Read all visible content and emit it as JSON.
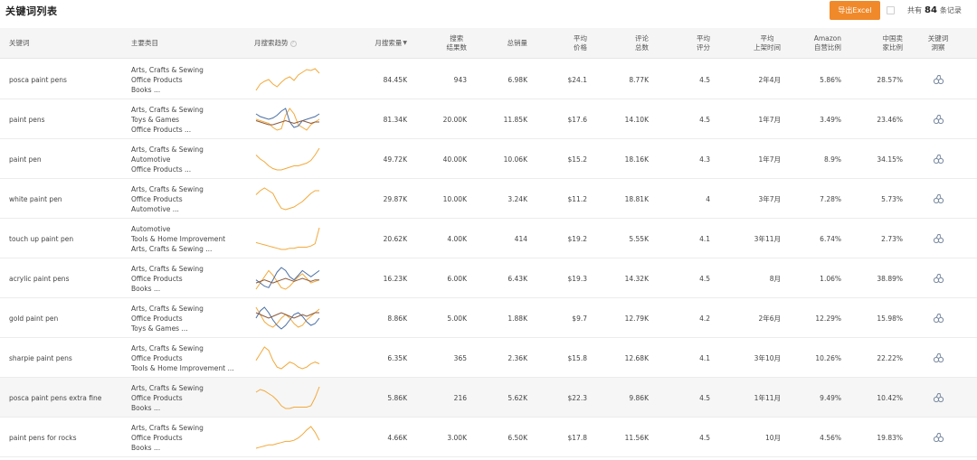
{
  "header": {
    "title": "关键词列表",
    "export_label": "导出Excel",
    "total_prefix": "共有",
    "total_count": "84",
    "total_suffix": "条记录"
  },
  "columns": {
    "keyword": "关键词",
    "category": "主要类目",
    "trend": "月搜索趋势",
    "volume": "月搜索量",
    "results_l1": "搜索",
    "results_l2": "结果数",
    "sales": "总销量",
    "price_l1": "平均",
    "price_l2": "价格",
    "reviews_l1": "评论",
    "reviews_l2": "总数",
    "rating_l1": "平均",
    "rating_l2": "评分",
    "time_l1": "平均",
    "time_l2": "上架时间",
    "amz_l1": "Amazon",
    "amz_l2": "自营比例",
    "cn_l1": "中国卖",
    "cn_l2": "家比例",
    "analysis_l1": "关键词",
    "analysis_l2": "洞察"
  },
  "colors": {
    "accent": "#f0892a",
    "trend_primary": "#f2a93b",
    "trend_secondary": "#4a6fa5",
    "trend_tertiary": "#8b5a3c",
    "analysis_icon": "#7a8aa0"
  },
  "icons": {
    "help": "question-circle-icon",
    "sort": "sort-desc-icon",
    "analysis": "keyword-insight-icon"
  },
  "rows": [
    {
      "keyword": "posca paint pens",
      "cat1": "Arts, Crafts & Sewing",
      "cat2": "Office Products",
      "cat3": "Books ...",
      "volume": "84.45K",
      "results": "943",
      "sales": "6.98K",
      "price": "$24.1",
      "reviews": "8.77K",
      "rating": "4.5",
      "time": "2年4月",
      "amz": "5.86%",
      "cn": "28.57%",
      "trend": [
        [
          5,
          12,
          15,
          17,
          12,
          9,
          14,
          18,
          20,
          16,
          22,
          25,
          28,
          27,
          29,
          24
        ]
      ]
    },
    {
      "keyword": "paint pens",
      "cat1": "Arts, Crafts & Sewing",
      "cat2": "Toys & Games",
      "cat3": "Office Products ...",
      "volume": "81.34K",
      "results": "20.00K",
      "sales": "11.85K",
      "price": "$17.6",
      "reviews": "14.10K",
      "rating": "4.5",
      "time": "1年7月",
      "amz": "3.49%",
      "cn": "23.46%",
      "trend": [
        [
          14,
          13,
          12,
          11,
          8,
          6,
          7,
          17,
          22,
          18,
          10,
          8,
          6,
          10,
          12,
          14
        ],
        [
          18,
          16,
          15,
          14,
          15,
          17,
          20,
          22,
          12,
          8,
          9,
          13,
          14,
          15,
          16,
          18
        ],
        [
          13,
          12,
          11,
          10,
          10,
          11,
          12,
          13,
          12,
          11,
          12,
          13,
          12,
          11,
          12,
          12
        ]
      ]
    },
    {
      "keyword": "paint pen",
      "cat1": "Arts, Crafts & Sewing",
      "cat2": "Automotive",
      "cat3": "Office Products ...",
      "volume": "49.72K",
      "results": "40.00K",
      "sales": "10.06K",
      "price": "$15.2",
      "reviews": "18.16K",
      "rating": "4.3",
      "time": "1年7月",
      "amz": "8.9%",
      "cn": "34.15%",
      "trend": [
        [
          20,
          17,
          15,
          12,
          10,
          9,
          9,
          10,
          11,
          12,
          12,
          13,
          14,
          16,
          20,
          25
        ]
      ]
    },
    {
      "keyword": "white paint pen",
      "cat1": "Arts, Crafts & Sewing",
      "cat2": "Office Products",
      "cat3": "Automotive ...",
      "volume": "29.87K",
      "results": "10.00K",
      "sales": "3.24K",
      "price": "$11.2",
      "reviews": "18.81K",
      "rating": "4",
      "time": "3年7月",
      "amz": "7.28%",
      "cn": "5.73%",
      "trend": [
        [
          19,
          22,
          24,
          22,
          20,
          14,
          9,
          8,
          9,
          10,
          12,
          14,
          17,
          20,
          22,
          22
        ]
      ]
    },
    {
      "keyword": "touch up paint pen",
      "cat1": "Automotive",
      "cat2": "Tools & Home Improvement",
      "cat3": "Arts, Crafts & Sewing ...",
      "volume": "20.62K",
      "results": "4.00K",
      "sales": "414",
      "price": "$19.2",
      "reviews": "5.55K",
      "rating": "4.1",
      "time": "3年11月",
      "amz": "6.74%",
      "cn": "2.73%",
      "trend": [
        [
          9,
          8,
          7,
          6,
          5,
          4,
          3,
          3,
          4,
          4,
          5,
          5,
          5,
          6,
          8,
          22
        ]
      ]
    },
    {
      "keyword": "acrylic paint pens",
      "cat1": "Arts, Crafts & Sewing",
      "cat2": "Office Products",
      "cat3": "Books ...",
      "volume": "16.23K",
      "results": "6.00K",
      "sales": "6.43K",
      "price": "$19.3",
      "reviews": "14.32K",
      "rating": "4.5",
      "time": "8月",
      "amz": "1.06%",
      "cn": "38.89%",
      "trend": [
        [
          8,
          12,
          16,
          20,
          17,
          13,
          9,
          8,
          10,
          13,
          16,
          18,
          15,
          12,
          13,
          14
        ],
        [
          14,
          12,
          10,
          9,
          14,
          19,
          22,
          20,
          16,
          14,
          17,
          20,
          18,
          16,
          18,
          20
        ],
        [
          12,
          13,
          14,
          13,
          12,
          13,
          14,
          15,
          14,
          13,
          14,
          15,
          14,
          13,
          14,
          14
        ]
      ]
    },
    {
      "keyword": "gold paint pen",
      "cat1": "Arts, Crafts & Sewing",
      "cat2": "Office Products",
      "cat3": "Toys & Games ...",
      "volume": "8.86K",
      "results": "5.00K",
      "sales": "1.88K",
      "price": "$9.7",
      "reviews": "12.79K",
      "rating": "4.2",
      "time": "2年6月",
      "amz": "12.29%",
      "cn": "15.98%",
      "trend": [
        [
          20,
          16,
          12,
          10,
          9,
          11,
          14,
          16,
          14,
          11,
          9,
          10,
          13,
          15,
          17,
          19
        ],
        [
          14,
          18,
          20,
          17,
          13,
          10,
          8,
          10,
          13,
          16,
          17,
          15,
          12,
          10,
          11,
          14
        ],
        [
          17,
          16,
          15,
          14,
          15,
          16,
          17,
          16,
          15,
          14,
          15,
          16,
          15,
          16,
          17,
          17
        ]
      ]
    },
    {
      "keyword": "sharpie paint pens",
      "cat1": "Arts, Crafts & Sewing",
      "cat2": "Office Products",
      "cat3": "Tools & Home Improvement ...",
      "volume": "6.35K",
      "results": "365",
      "sales": "2.36K",
      "price": "$15.8",
      "reviews": "12.68K",
      "rating": "4.1",
      "time": "3年10月",
      "amz": "10.26%",
      "cn": "22.22%",
      "trend": [
        [
          14,
          18,
          22,
          20,
          14,
          10,
          9,
          11,
          13,
          12,
          10,
          9,
          10,
          12,
          13,
          12
        ]
      ]
    },
    {
      "keyword": "posca paint pens extra fine",
      "cat1": "Arts, Crafts & Sewing",
      "cat2": "Office Products",
      "cat3": "Books ...",
      "volume": "5.86K",
      "results": "216",
      "sales": "5.62K",
      "price": "$22.3",
      "reviews": "9.86K",
      "rating": "4.5",
      "time": "1年11月",
      "amz": "9.49%",
      "cn": "10.42%",
      "trend": [
        [
          18,
          20,
          19,
          17,
          15,
          12,
          8,
          6,
          6,
          7,
          7,
          7,
          7,
          8,
          14,
          22
        ]
      ]
    },
    {
      "keyword": "paint pens for rocks",
      "cat1": "Arts, Crafts & Sewing",
      "cat2": "Office Products",
      "cat3": "Books ...",
      "volume": "4.66K",
      "results": "3.00K",
      "sales": "6.50K",
      "price": "$17.8",
      "reviews": "11.56K",
      "rating": "4.5",
      "time": "10月",
      "amz": "4.56%",
      "cn": "19.83%",
      "trend": [
        [
          6,
          7,
          8,
          9,
          9,
          10,
          11,
          12,
          12,
          13,
          15,
          18,
          22,
          25,
          20,
          13
        ]
      ]
    }
  ]
}
